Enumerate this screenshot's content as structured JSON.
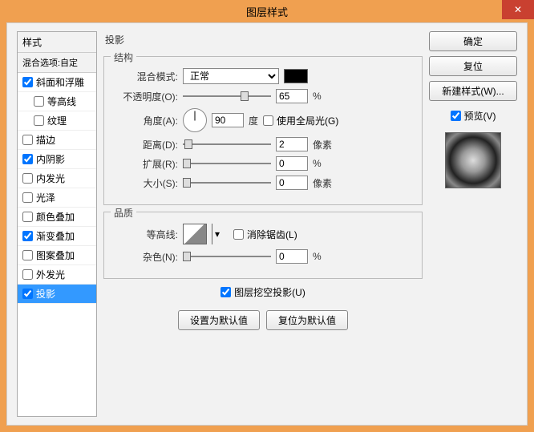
{
  "window": {
    "title": "图层样式"
  },
  "styles_panel": {
    "header": "样式",
    "subheader": "混合选项:自定",
    "items": [
      {
        "label": "斜面和浮雕",
        "checked": true,
        "indent": false
      },
      {
        "label": "等高线",
        "checked": false,
        "indent": true
      },
      {
        "label": "纹理",
        "checked": false,
        "indent": true
      },
      {
        "label": "描边",
        "checked": false,
        "indent": false
      },
      {
        "label": "内阴影",
        "checked": true,
        "indent": false
      },
      {
        "label": "内发光",
        "checked": false,
        "indent": false
      },
      {
        "label": "光泽",
        "checked": false,
        "indent": false
      },
      {
        "label": "颜色叠加",
        "checked": false,
        "indent": false
      },
      {
        "label": "渐变叠加",
        "checked": true,
        "indent": false
      },
      {
        "label": "图案叠加",
        "checked": false,
        "indent": false
      },
      {
        "label": "外发光",
        "checked": false,
        "indent": false
      },
      {
        "label": "投影",
        "checked": true,
        "indent": false,
        "selected": true
      }
    ]
  },
  "main": {
    "title": "投影",
    "structure": {
      "legend": "结构",
      "blend_mode_label": "混合模式:",
      "blend_mode_value": "正常",
      "opacity_label": "不透明度(O):",
      "opacity_value": "65",
      "opacity_unit": "%",
      "angle_label": "角度(A):",
      "angle_value": "90",
      "angle_unit": "度",
      "global_light_label": "使用全局光(G)",
      "global_light_checked": false,
      "distance_label": "距离(D):",
      "distance_value": "2",
      "distance_unit": "像素",
      "spread_label": "扩展(R):",
      "spread_value": "0",
      "spread_unit": "%",
      "size_label": "大小(S):",
      "size_value": "0",
      "size_unit": "像素"
    },
    "quality": {
      "legend": "品质",
      "contour_label": "等高线:",
      "antialias_label": "消除锯齿(L)",
      "antialias_checked": false,
      "noise_label": "杂色(N):",
      "noise_value": "0",
      "noise_unit": "%"
    },
    "knockout_label": "图层挖空投影(U)",
    "knockout_checked": true,
    "set_default": "设置为默认值",
    "reset_default": "复位为默认值"
  },
  "right": {
    "ok": "确定",
    "cancel": "复位",
    "new_style": "新建样式(W)...",
    "preview_label": "预览(V)",
    "preview_checked": true
  }
}
